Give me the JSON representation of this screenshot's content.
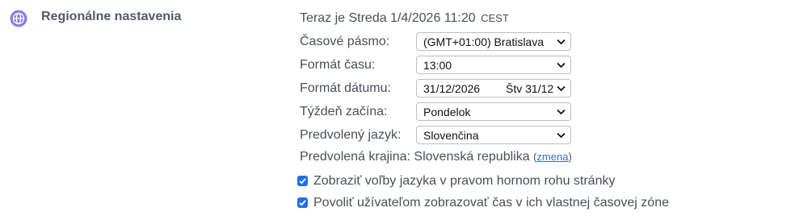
{
  "section": {
    "icon": "globe-icon",
    "title": "Regionálne nastavenia",
    "accent_color": "#8b7fe0"
  },
  "now": {
    "prefix": "Teraz je Streda 1/4/2026 11:20",
    "timezone_abbr": "CEST"
  },
  "fields": {
    "timezone": {
      "label": "Časové pásmo:",
      "value": "(GMT+01:00) Bratislava"
    },
    "time_format": {
      "label": "Formát času:",
      "value": "13:00"
    },
    "date_format": {
      "label": "Formát dátumu:",
      "value": "31/12/2026",
      "value_alt": "Štv 31/12"
    },
    "week_start": {
      "label": "Týždeň začína:",
      "value": "Pondelok"
    },
    "language": {
      "label": "Predvolený jazyk:",
      "value": "Slovenčina"
    }
  },
  "region": {
    "text": "Predvolená krajina: Slovenská republika",
    "open_paren": "(",
    "change_link": "zmena",
    "close_paren": ")"
  },
  "options": [
    {
      "label": "Zobraziť voľby jazyka v pravom hornom rohu stránky",
      "checked": true
    },
    {
      "label": "Povoliť užívateľom zobrazovať čas v ich vlastnej časovej zóne",
      "checked": true
    }
  ],
  "colors": {
    "checkbox": "#1f6fe5",
    "link": "#2a6fd6"
  }
}
